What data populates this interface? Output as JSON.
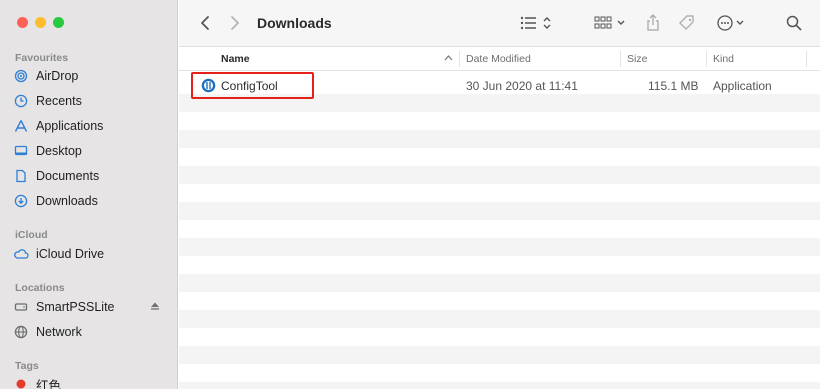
{
  "window": {
    "title": "Downloads"
  },
  "sidebar": {
    "sections": [
      {
        "title": "Favourites",
        "items": [
          {
            "label": "AirDrop",
            "icon": "airdrop-icon"
          },
          {
            "label": "Recents",
            "icon": "clock-icon"
          },
          {
            "label": "Applications",
            "icon": "applications-icon"
          },
          {
            "label": "Desktop",
            "icon": "desktop-icon"
          },
          {
            "label": "Documents",
            "icon": "document-icon"
          },
          {
            "label": "Downloads",
            "icon": "downloads-icon"
          }
        ]
      },
      {
        "title": "iCloud",
        "items": [
          {
            "label": "iCloud Drive",
            "icon": "cloud-icon"
          }
        ]
      },
      {
        "title": "Locations",
        "items": [
          {
            "label": "SmartPSSLite",
            "icon": "disk-icon"
          },
          {
            "label": "Network",
            "icon": "network-icon"
          }
        ]
      },
      {
        "title": "Tags",
        "items": [
          {
            "label": "红色",
            "icon": "red-tag-icon"
          }
        ]
      }
    ]
  },
  "columns": {
    "name": "Name",
    "date_modified": "Date Modified",
    "size": "Size",
    "kind": "Kind"
  },
  "files": [
    {
      "name": "ConfigTool",
      "date_modified": "30 Jun 2020 at 11:41",
      "size": "115.1 MB",
      "kind": "Application"
    }
  ],
  "colors": {
    "accent": "#2e7fd6",
    "highlight": "#e5221a"
  }
}
